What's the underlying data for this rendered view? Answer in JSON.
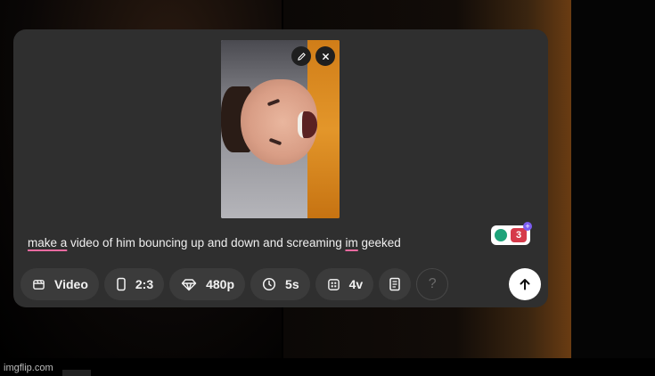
{
  "composer": {
    "prompt_segments": [
      {
        "text": "make a",
        "style": "spell"
      },
      {
        "text": " video of him bouncing up and down and screaming ",
        "style": "plain"
      },
      {
        "text": "im",
        "style": "spell"
      },
      {
        "text": " geeked",
        "style": "plain"
      }
    ],
    "reference_image": {
      "edit_icon": "pencil-icon",
      "remove_icon": "close-icon"
    },
    "grammar_widget": {
      "issue_count": "3",
      "plus": "+"
    }
  },
  "toolbar": {
    "type_label": "Video",
    "aspect_label": "2:3",
    "resolution_label": "480p",
    "duration_label": "5s",
    "variations_label": "4v",
    "presets_icon": "notebook-icon",
    "help_label": "?"
  },
  "submit": {
    "icon": "arrow-up-icon"
  },
  "watermark": "imgflip.com",
  "colors": {
    "panel": "#2f2f2f",
    "pill": "#3b3b3b",
    "spell_underline": "#e86aa0",
    "submit": "#ffffff"
  }
}
